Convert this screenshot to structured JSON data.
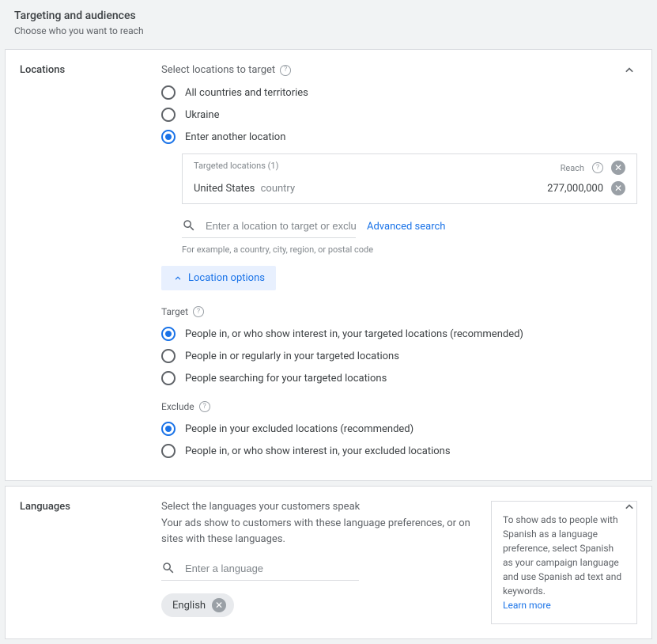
{
  "header": {
    "title": "Targeting and audiences",
    "subtitle": "Choose who you want to reach"
  },
  "locations": {
    "label": "Locations",
    "selectHeading": "Select locations to target",
    "radios": {
      "all": "All countries and territories",
      "ukraine": "Ukraine",
      "another": "Enter another location"
    },
    "targetedBox": {
      "headerLeft": "Targeted locations (1)",
      "headerRight": "Reach",
      "location": "United States",
      "locationType": "country",
      "reach": "277,000,000"
    },
    "searchPlaceholder": "Enter a location to target or exclude",
    "advancedSearch": "Advanced search",
    "example": "For example, a country, city, region, or postal code",
    "locationOptions": "Location options",
    "targetHeading": "Target",
    "targetRadios": {
      "interest": "People in, or who show interest in, your targeted locations (recommended)",
      "regularly": "People in or regularly in your targeted locations",
      "searching": "People searching for your targeted locations"
    },
    "excludeHeading": "Exclude",
    "excludeRadios": {
      "inExcluded": "People in your excluded locations (recommended)",
      "interestExcluded": "People in, or who show interest in, your excluded locations"
    }
  },
  "languages": {
    "label": "Languages",
    "heading": "Select the languages your customers speak",
    "description": "Your ads show to customers with these language preferences, or on sites with these languages.",
    "inputPlaceholder": "Enter a language",
    "chip": "English",
    "tip": "To show ads to people with Spanish as a language preference, select Spanish as your campaign language and use Spanish ad text and keywords.",
    "learnMore": "Learn more"
  }
}
